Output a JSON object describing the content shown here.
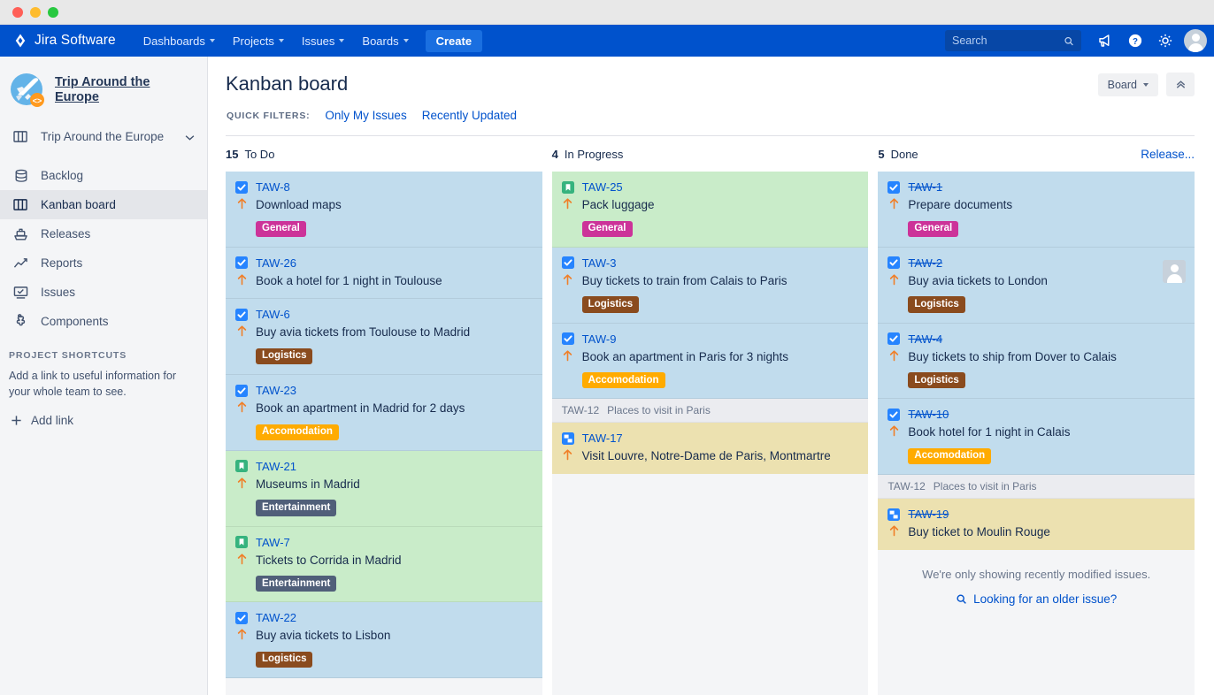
{
  "window": {
    "controls": [
      "close",
      "minimize",
      "maximize"
    ]
  },
  "topnav": {
    "brand": "Jira Software",
    "items": [
      {
        "label": "Dashboards",
        "icon": "chevron-down-icon"
      },
      {
        "label": "Projects",
        "icon": "chevron-down-icon"
      },
      {
        "label": "Issues",
        "icon": "chevron-down-icon"
      },
      {
        "label": "Boards",
        "icon": "chevron-down-icon"
      }
    ],
    "create_label": "Create",
    "search_placeholder": "Search",
    "icons": [
      "search-icon",
      "megaphone-icon",
      "help-icon",
      "gear-icon",
      "user-avatar"
    ]
  },
  "sidebar": {
    "project_name": "Trip Around the Europe",
    "project_switcher": "Trip Around the Europe",
    "items": [
      {
        "label": "Backlog",
        "icon": "backlog-icon",
        "active": false
      },
      {
        "label": "Kanban board",
        "icon": "board-icon",
        "active": true
      },
      {
        "label": "Releases",
        "icon": "releases-icon",
        "active": false
      },
      {
        "label": "Reports",
        "icon": "reports-icon",
        "active": false
      },
      {
        "label": "Issues",
        "icon": "issues-icon",
        "active": false
      },
      {
        "label": "Components",
        "icon": "components-icon",
        "active": false
      }
    ],
    "shortcuts_title": "PROJECT SHORTCUTS",
    "shortcuts_desc": "Add a link to useful information for your whole team to see.",
    "add_link_label": "Add link"
  },
  "board": {
    "title": "Kanban board",
    "board_button": "Board",
    "collapse_icon": "chevrons-up-icon",
    "quick_filters_label": "QUICK FILTERS:",
    "quick_filters": [
      "Only My Issues",
      "Recently Updated"
    ],
    "release_link": "Release...",
    "columns": [
      {
        "count": "15",
        "name": "To Do",
        "cards": [
          {
            "key": "TAW-8",
            "summary": "Download maps",
            "type": "task",
            "color": "blue",
            "labels": [
              {
                "text": "General",
                "color": "#cc3399"
              }
            ],
            "done": false
          },
          {
            "key": "TAW-26",
            "summary": "Book a hotel for 1 night in Toulouse",
            "type": "task",
            "color": "blue",
            "labels": [],
            "done": false
          },
          {
            "key": "TAW-6",
            "summary": "Buy avia tickets from Toulouse to Madrid",
            "type": "task",
            "color": "blue",
            "labels": [
              {
                "text": "Logistics",
                "color": "#8a4b1e"
              }
            ],
            "done": false
          },
          {
            "key": "TAW-23",
            "summary": "Book an apartment in Madrid for 2 days",
            "type": "task",
            "color": "blue",
            "labels": [
              {
                "text": "Accomodation",
                "color": "#ffab00"
              }
            ],
            "done": false
          },
          {
            "key": "TAW-21",
            "summary": "Museums in Madrid",
            "type": "story",
            "color": "green",
            "labels": [
              {
                "text": "Entertainment",
                "color": "#505f79"
              }
            ],
            "done": false
          },
          {
            "key": "TAW-7",
            "summary": "Tickets to Corrida in Madrid",
            "type": "story",
            "color": "green",
            "labels": [
              {
                "text": "Entertainment",
                "color": "#505f79"
              }
            ],
            "done": false
          },
          {
            "key": "TAW-22",
            "summary": "Buy avia tickets to Lisbon",
            "type": "task",
            "color": "blue",
            "labels": [
              {
                "text": "Logistics",
                "color": "#8a4b1e"
              }
            ],
            "done": false
          }
        ]
      },
      {
        "count": "4",
        "name": "In Progress",
        "cards": [
          {
            "key": "TAW-25",
            "summary": "Pack luggage",
            "type": "story",
            "color": "green",
            "labels": [
              {
                "text": "General",
                "color": "#cc3399"
              }
            ],
            "done": false
          },
          {
            "key": "TAW-3",
            "summary": "Buy tickets to train from Calais to Paris",
            "type": "task",
            "color": "blue",
            "labels": [
              {
                "text": "Logistics",
                "color": "#8a4b1e"
              }
            ],
            "done": false
          },
          {
            "key": "TAW-9",
            "summary": "Book an apartment in Paris for 3 nights",
            "type": "task",
            "color": "blue",
            "labels": [
              {
                "text": "Accomodation",
                "color": "#ffab00"
              }
            ],
            "done": false
          }
        ],
        "epic": {
          "key": "TAW-12",
          "name": "Places to visit in Paris",
          "cards": [
            {
              "key": "TAW-17",
              "summary": "Visit Louvre, Notre-Dame de Paris, Montmartre",
              "type": "subtask",
              "color": "yellow",
              "labels": [],
              "done": false
            }
          ]
        }
      },
      {
        "count": "5",
        "name": "Done",
        "cards": [
          {
            "key": "TAW-1",
            "summary": "Prepare documents",
            "type": "task",
            "color": "blue",
            "labels": [
              {
                "text": "General",
                "color": "#cc3399"
              }
            ],
            "done": true
          },
          {
            "key": "TAW-2",
            "summary": "Buy avia tickets to London",
            "type": "task",
            "color": "blue",
            "labels": [
              {
                "text": "Logistics",
                "color": "#8a4b1e"
              }
            ],
            "done": true,
            "avatar": true
          },
          {
            "key": "TAW-4",
            "summary": "Buy tickets to ship from Dover to Calais",
            "type": "task",
            "color": "blue",
            "labels": [
              {
                "text": "Logistics",
                "color": "#8a4b1e"
              }
            ],
            "done": true
          },
          {
            "key": "TAW-10",
            "summary": "Book hotel for 1 night in Calais",
            "type": "task",
            "color": "blue",
            "labels": [
              {
                "text": "Accomodation",
                "color": "#ffab00"
              }
            ],
            "done": true
          }
        ],
        "epic": {
          "key": "TAW-12",
          "name": "Places to visit in Paris",
          "cards": [
            {
              "key": "TAW-19",
              "summary": "Buy ticket to Moulin Rouge",
              "type": "subtask",
              "color": "yellow",
              "labels": [],
              "done": true
            }
          ]
        },
        "footer_note": "We're only showing recently modified issues.",
        "footer_link": "Looking for an older issue?"
      }
    ]
  }
}
